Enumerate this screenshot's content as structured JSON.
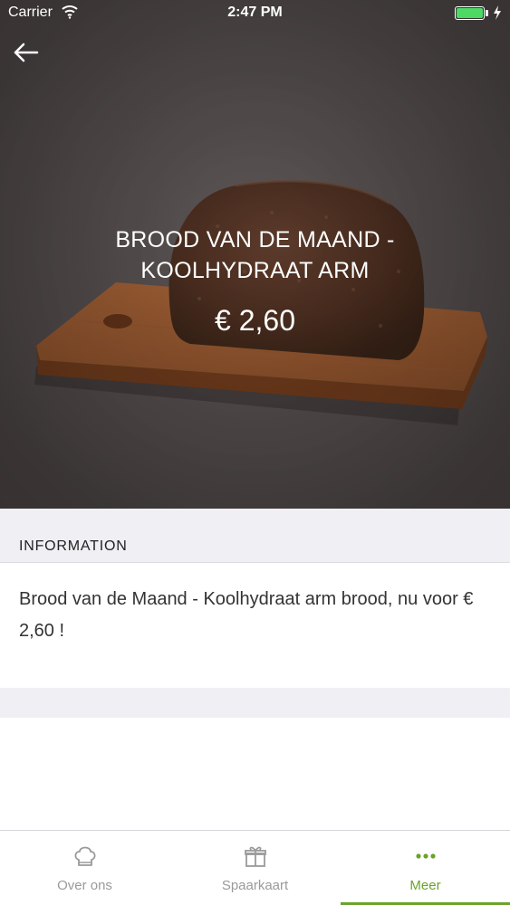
{
  "status_bar": {
    "carrier": "Carrier",
    "time": "2:47 PM",
    "battery_color": "#4cd964"
  },
  "header": {
    "back_icon": "arrow-left-icon"
  },
  "product": {
    "title": "BROOD VAN DE MAAND - KOOLHYDRAAT ARM",
    "price": "€ 2,60",
    "image": "bread-on-cutting-board"
  },
  "info_section": {
    "header": "INFORMATION",
    "text": "Brood van de Maand - Koolhydraat arm brood, nu voor € 2,60 !"
  },
  "tab_bar": {
    "accent_color": "#6aa32a",
    "tabs": [
      {
        "label": "Over ons",
        "icon": "chef-hat-icon",
        "active": false
      },
      {
        "label": "Spaarkaart",
        "icon": "gift-icon",
        "active": false
      },
      {
        "label": "Meer",
        "icon": "more-dots-icon",
        "active": true
      }
    ]
  }
}
